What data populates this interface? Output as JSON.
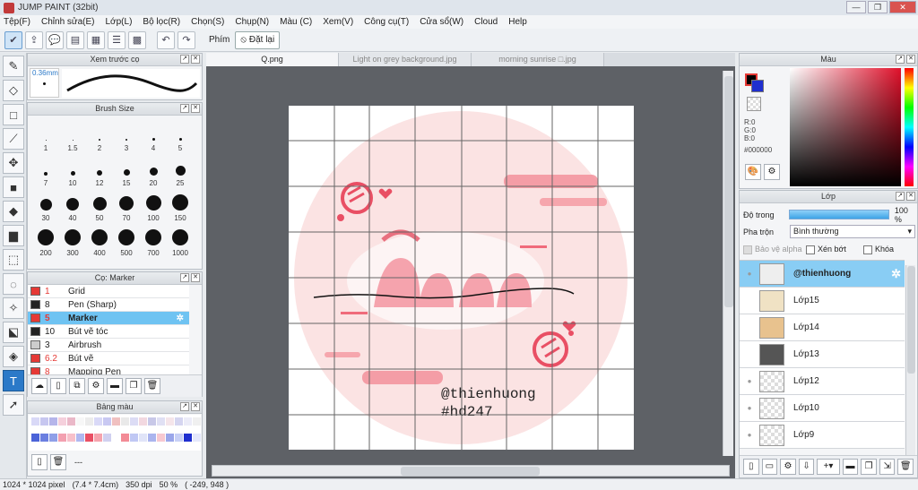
{
  "title": "JUMP PAINT (32bit)",
  "menu": [
    "Tệp(F)",
    "Chỉnh sửa(E)",
    "Lớp(L)",
    "Bộ lọc(R)",
    "Chọn(S)",
    "Chụp(N)",
    "Màu (C)",
    "Xem(V)",
    "Công cụ(T)",
    "Cửa sổ(W)",
    "Cloud",
    "Help"
  ],
  "toolbar": {
    "key_label": "Phím",
    "reset_label": "Đặt lại"
  },
  "preview_panel": {
    "title": "Xem trước cọ",
    "size": "0.36mm"
  },
  "brush_size_panel": {
    "title": "Brush Size",
    "sizes": [
      "1",
      "1.5",
      "2",
      "3",
      "4",
      "5",
      "7",
      "10",
      "12",
      "15",
      "20",
      "25",
      "30",
      "40",
      "50",
      "70",
      "100",
      "150",
      "200",
      "300",
      "400",
      "500",
      "700",
      "1000"
    ]
  },
  "brush_panel": {
    "title": "Cọ: Marker",
    "items": [
      {
        "num": "1",
        "name": "Grid",
        "color": "#e53935"
      },
      {
        "num": "8",
        "name": "Pen (Sharp)",
        "color": "#222222"
      },
      {
        "num": "5",
        "name": "Marker",
        "color": "#e53935"
      },
      {
        "num": "10",
        "name": "Bút vẽ tóc",
        "color": "#222222"
      },
      {
        "num": "3",
        "name": "Airbrush",
        "color": "#cccccc"
      },
      {
        "num": "6.2",
        "name": "Bút vẽ",
        "color": "#e53935"
      },
      {
        "num": "8",
        "name": "Mapping Pen",
        "color": "#e53935"
      }
    ]
  },
  "palette_panel": {
    "title": "Bảng màu",
    "extra": "---"
  },
  "tabs": [
    "Q.png",
    "Light on grey background.jpg",
    "morning sunrise □.jpg"
  ],
  "artwork": {
    "watermark1": "@thienhuong",
    "watermark2": "#hd247"
  },
  "color_panel": {
    "title": "Màu",
    "r": "R:0",
    "g": "G:0",
    "b": "B:0",
    "hex": "#000000"
  },
  "layer_panel": {
    "title": "Lớp",
    "opacity_label": "Độ trong",
    "opacity_value": "100 %",
    "opacity": 1.0,
    "blend_label": "Pha trộn",
    "blend_value": "Bình thường",
    "protect_alpha": "Bảo vệ alpha",
    "clipping": "Xén bớt",
    "lock": "Khóa",
    "layers": [
      "@thienhuong",
      "Lớp15",
      "Lớp14",
      "Lớp13",
      "Lớp12",
      "Lớp10",
      "Lớp9"
    ]
  },
  "status": {
    "size": "1024 * 1024 pixel",
    "cm": "(7.4 * 7.4cm)",
    "dpi": "350 dpi",
    "zoom": "50 %",
    "coords": "( -249, 948 )"
  },
  "colors": {
    "accent": "#2b79c8",
    "selection": "#6fc3f2",
    "pink": "#f07080"
  }
}
